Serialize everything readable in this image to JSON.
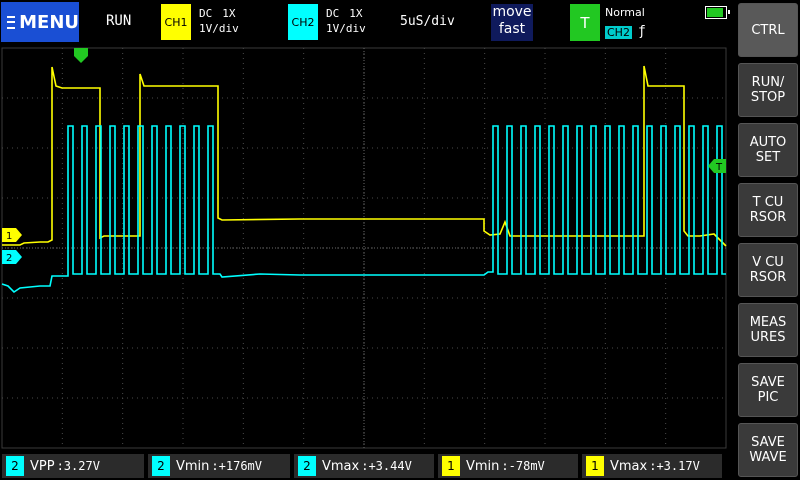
{
  "topbar": {
    "menu_label": "MENU",
    "run_state": "RUN",
    "ch1": {
      "badge": "CH1",
      "coupling": "DC",
      "probe": "1X",
      "scale": "1V/div",
      "color": "#ffff00"
    },
    "ch2": {
      "badge": "CH2",
      "coupling": "DC",
      "probe": "1X",
      "scale": "1V/div",
      "color": "#00ffff"
    },
    "timebase": "5uS/div",
    "move": {
      "line1": "move",
      "line2": "fast"
    },
    "trigger": {
      "badge": "T",
      "mode": "Normal",
      "source": "CH2",
      "edge": "ƒ"
    },
    "battery_icon": "battery-icon"
  },
  "scope": {
    "ch1_marker": "1",
    "ch2_marker": "2",
    "trigger_level_marker": "T",
    "grid_color": "#3a3a3a"
  },
  "side_buttons": [
    {
      "id": "ctrl",
      "label": "CTRL"
    },
    {
      "id": "run-stop",
      "label": "RUN/\nSTOP"
    },
    {
      "id": "auto-set",
      "label": "AUTO\nSET"
    },
    {
      "id": "t-cursor",
      "label": "T CU\nRSOR"
    },
    {
      "id": "v-cursor",
      "label": "V CU\nRSOR"
    },
    {
      "id": "measures",
      "label": "MEAS\nURES"
    },
    {
      "id": "save-pic",
      "label": "SAVE\nPIC"
    },
    {
      "id": "save-wave",
      "label": "SAVE\nWAVE"
    }
  ],
  "measurements": [
    {
      "ch": "2",
      "name": "VPP",
      "value": ":3.27V"
    },
    {
      "ch": "2",
      "name": "Vmin",
      "value": ":+176mV"
    },
    {
      "ch": "2",
      "name": "Vmax",
      "value": ":+3.44V"
    },
    {
      "ch": "1",
      "name": "Vmin",
      "value": ":-78mV"
    },
    {
      "ch": "1",
      "name": "Vmax",
      "value": ":+3.17V"
    }
  ]
}
